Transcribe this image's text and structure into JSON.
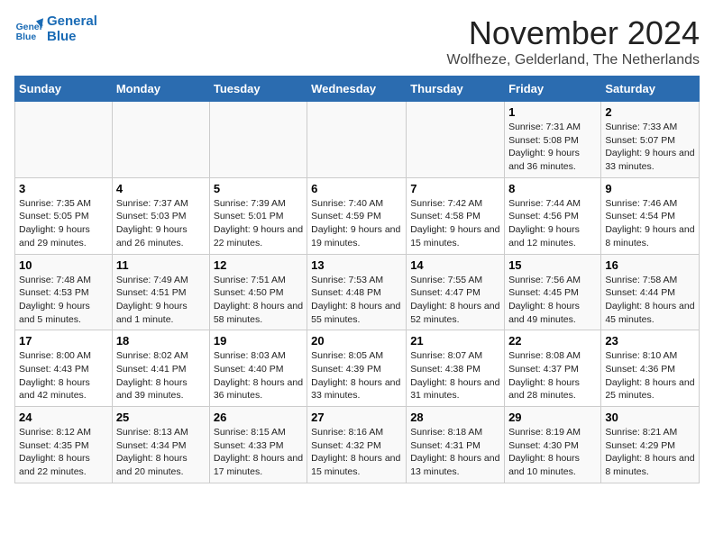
{
  "logo": {
    "line1": "General",
    "line2": "Blue"
  },
  "title": "November 2024",
  "location": "Wolfheze, Gelderland, The Netherlands",
  "weekdays": [
    "Sunday",
    "Monday",
    "Tuesday",
    "Wednesday",
    "Thursday",
    "Friday",
    "Saturday"
  ],
  "weeks": [
    [
      {
        "day": "",
        "info": ""
      },
      {
        "day": "",
        "info": ""
      },
      {
        "day": "",
        "info": ""
      },
      {
        "day": "",
        "info": ""
      },
      {
        "day": "",
        "info": ""
      },
      {
        "day": "1",
        "info": "Sunrise: 7:31 AM\nSunset: 5:08 PM\nDaylight: 9 hours and 36 minutes."
      },
      {
        "day": "2",
        "info": "Sunrise: 7:33 AM\nSunset: 5:07 PM\nDaylight: 9 hours and 33 minutes."
      }
    ],
    [
      {
        "day": "3",
        "info": "Sunrise: 7:35 AM\nSunset: 5:05 PM\nDaylight: 9 hours and 29 minutes."
      },
      {
        "day": "4",
        "info": "Sunrise: 7:37 AM\nSunset: 5:03 PM\nDaylight: 9 hours and 26 minutes."
      },
      {
        "day": "5",
        "info": "Sunrise: 7:39 AM\nSunset: 5:01 PM\nDaylight: 9 hours and 22 minutes."
      },
      {
        "day": "6",
        "info": "Sunrise: 7:40 AM\nSunset: 4:59 PM\nDaylight: 9 hours and 19 minutes."
      },
      {
        "day": "7",
        "info": "Sunrise: 7:42 AM\nSunset: 4:58 PM\nDaylight: 9 hours and 15 minutes."
      },
      {
        "day": "8",
        "info": "Sunrise: 7:44 AM\nSunset: 4:56 PM\nDaylight: 9 hours and 12 minutes."
      },
      {
        "day": "9",
        "info": "Sunrise: 7:46 AM\nSunset: 4:54 PM\nDaylight: 9 hours and 8 minutes."
      }
    ],
    [
      {
        "day": "10",
        "info": "Sunrise: 7:48 AM\nSunset: 4:53 PM\nDaylight: 9 hours and 5 minutes."
      },
      {
        "day": "11",
        "info": "Sunrise: 7:49 AM\nSunset: 4:51 PM\nDaylight: 9 hours and 1 minute."
      },
      {
        "day": "12",
        "info": "Sunrise: 7:51 AM\nSunset: 4:50 PM\nDaylight: 8 hours and 58 minutes."
      },
      {
        "day": "13",
        "info": "Sunrise: 7:53 AM\nSunset: 4:48 PM\nDaylight: 8 hours and 55 minutes."
      },
      {
        "day": "14",
        "info": "Sunrise: 7:55 AM\nSunset: 4:47 PM\nDaylight: 8 hours and 52 minutes."
      },
      {
        "day": "15",
        "info": "Sunrise: 7:56 AM\nSunset: 4:45 PM\nDaylight: 8 hours and 49 minutes."
      },
      {
        "day": "16",
        "info": "Sunrise: 7:58 AM\nSunset: 4:44 PM\nDaylight: 8 hours and 45 minutes."
      }
    ],
    [
      {
        "day": "17",
        "info": "Sunrise: 8:00 AM\nSunset: 4:43 PM\nDaylight: 8 hours and 42 minutes."
      },
      {
        "day": "18",
        "info": "Sunrise: 8:02 AM\nSunset: 4:41 PM\nDaylight: 8 hours and 39 minutes."
      },
      {
        "day": "19",
        "info": "Sunrise: 8:03 AM\nSunset: 4:40 PM\nDaylight: 8 hours and 36 minutes."
      },
      {
        "day": "20",
        "info": "Sunrise: 8:05 AM\nSunset: 4:39 PM\nDaylight: 8 hours and 33 minutes."
      },
      {
        "day": "21",
        "info": "Sunrise: 8:07 AM\nSunset: 4:38 PM\nDaylight: 8 hours and 31 minutes."
      },
      {
        "day": "22",
        "info": "Sunrise: 8:08 AM\nSunset: 4:37 PM\nDaylight: 8 hours and 28 minutes."
      },
      {
        "day": "23",
        "info": "Sunrise: 8:10 AM\nSunset: 4:36 PM\nDaylight: 8 hours and 25 minutes."
      }
    ],
    [
      {
        "day": "24",
        "info": "Sunrise: 8:12 AM\nSunset: 4:35 PM\nDaylight: 8 hours and 22 minutes."
      },
      {
        "day": "25",
        "info": "Sunrise: 8:13 AM\nSunset: 4:34 PM\nDaylight: 8 hours and 20 minutes."
      },
      {
        "day": "26",
        "info": "Sunrise: 8:15 AM\nSunset: 4:33 PM\nDaylight: 8 hours and 17 minutes."
      },
      {
        "day": "27",
        "info": "Sunrise: 8:16 AM\nSunset: 4:32 PM\nDaylight: 8 hours and 15 minutes."
      },
      {
        "day": "28",
        "info": "Sunrise: 8:18 AM\nSunset: 4:31 PM\nDaylight: 8 hours and 13 minutes."
      },
      {
        "day": "29",
        "info": "Sunrise: 8:19 AM\nSunset: 4:30 PM\nDaylight: 8 hours and 10 minutes."
      },
      {
        "day": "30",
        "info": "Sunrise: 8:21 AM\nSunset: 4:29 PM\nDaylight: 8 hours and 8 minutes."
      }
    ]
  ]
}
